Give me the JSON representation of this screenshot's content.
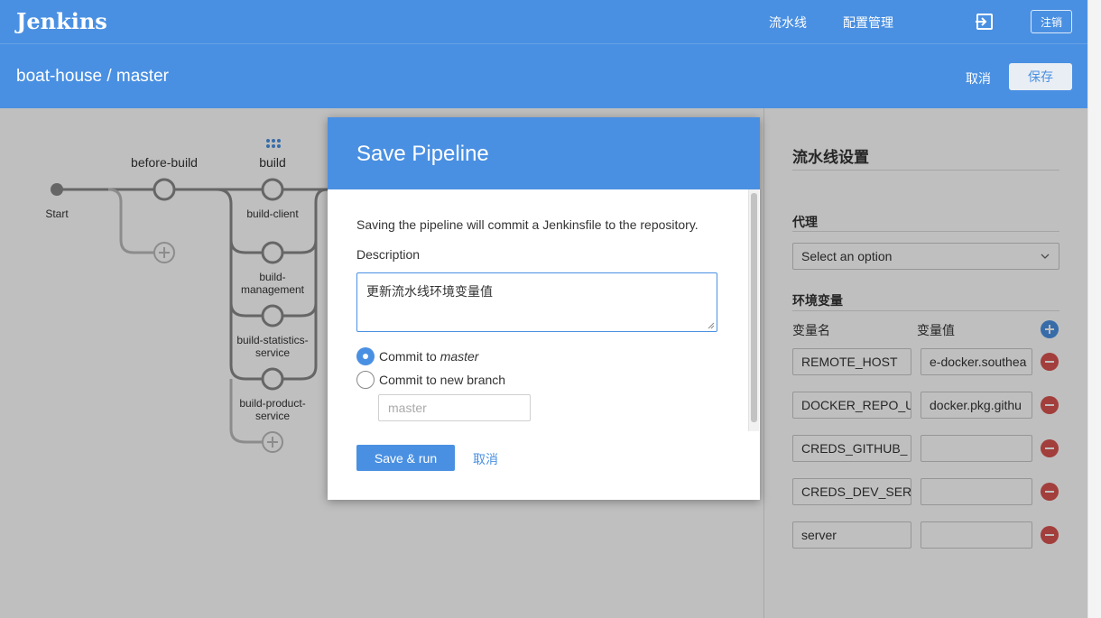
{
  "header": {
    "logo": "Jenkins",
    "nav": [
      "流水线",
      "配置管理"
    ],
    "logout_label": "注销"
  },
  "subheader": {
    "title": "boat-house / master",
    "cancel_label": "取消",
    "save_label": "保存"
  },
  "pipeline": {
    "stages": [
      {
        "label": "before-build",
        "nodes": []
      },
      {
        "label": "build",
        "nodes": [
          "build-client",
          "build-management",
          "build-statistics-service",
          "build-product-service"
        ]
      }
    ],
    "start_label": "Start",
    "node_labels": {
      "client": "build-client",
      "management_1": "build-",
      "management_2": "management",
      "statistics_1": "build-statistics-",
      "statistics_2": "service",
      "product_1": "build-product-",
      "product_2": "service"
    }
  },
  "settings": {
    "title": "流水线设置",
    "agent_label": "代理",
    "agent_select": "Select an option",
    "env_label": "环境变量",
    "col_name": "变量名",
    "col_value": "变量值",
    "variables": [
      {
        "name": "REMOTE_HOST",
        "value": "e-docker.southea"
      },
      {
        "name": "DOCKER_REPO_U",
        "value": "docker.pkg.githu"
      },
      {
        "name": "CREDS_GITHUB_",
        "value": ""
      },
      {
        "name": "CREDS_DEV_SER",
        "value": ""
      },
      {
        "name": "server",
        "value": ""
      }
    ]
  },
  "modal": {
    "title": "Save Pipeline",
    "info": "Saving the pipeline will commit a Jenkinsfile to the repository.",
    "description_label": "Description",
    "description_value": "更新流水线环境变量值",
    "commit_prefix": "Commit to",
    "commit_branch": "master",
    "commit_new_label": "Commit to new branch",
    "branch_placeholder": "master",
    "save_run_label": "Save & run",
    "cancel_label": "取消"
  },
  "colors": {
    "accent": "#4a90e2",
    "danger": "#d9534f"
  }
}
